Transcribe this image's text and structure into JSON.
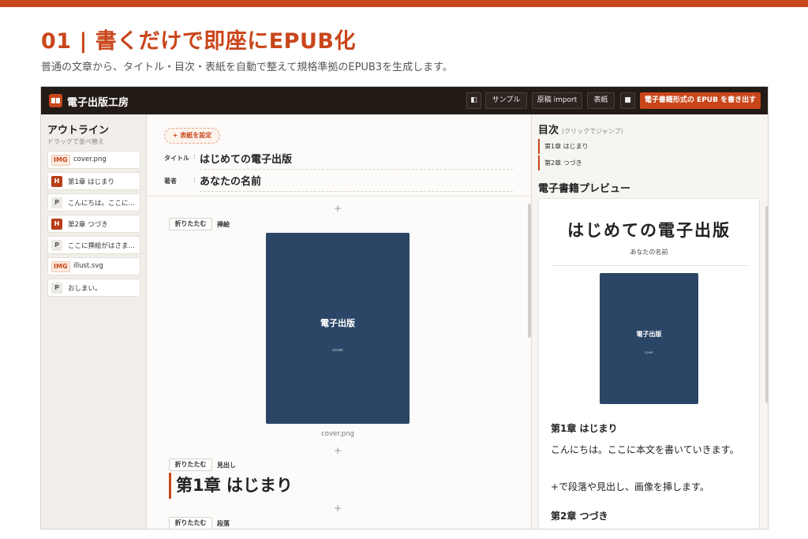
{
  "heading": "01 | 書くだけで即座にEPUB化",
  "subheading": "普通の文章から、タイトル・目次・表紙を自動で整えて規格準拠のEPUB3を生成します。",
  "app": {
    "title": "電子出版工房",
    "buttons": {
      "layout_icon": "◧",
      "sample": "サンプル",
      "import": "原稿 import",
      "cover": "表紙",
      "square_icon": "■",
      "export": "電子書籍形式の EPUB を書き出す"
    }
  },
  "sidebar": {
    "title": "アウトライン",
    "subtitle": "ドラッグで並べ替え",
    "items": [
      {
        "badge": "IMG",
        "kind": "img",
        "label": "cover.png"
      },
      {
        "badge": "H",
        "kind": "h",
        "label": "第1章 はじまり"
      },
      {
        "badge": "P",
        "kind": "p",
        "label": "こんにちは。ここに…"
      },
      {
        "badge": "H",
        "kind": "h",
        "label": "第2章 つづき"
      },
      {
        "badge": "P",
        "kind": "p",
        "label": "ここに挿絵がはさま…"
      },
      {
        "badge": "IMG",
        "kind": "img",
        "label": "illust.svg"
      },
      {
        "badge": "P",
        "kind": "p",
        "label": "おしまい。"
      }
    ]
  },
  "editor": {
    "cover_button": "+ 表紙を設定",
    "title_label": "タイトル",
    "title_value": "はじめての電子出版",
    "author_label": "著者",
    "author_value": "あなたの名前",
    "colon": ":",
    "plus": "+",
    "fold_label": "折りたたむ",
    "block1_type": "挿絵",
    "cover_title": "電子出版",
    "cover_sub": "cover",
    "cover_caption": "cover.png",
    "block2_type": "見出し",
    "chapter_heading": "第1章 はじまり",
    "block3_type": "段落"
  },
  "toc": {
    "title": "目次",
    "hint": "(クリックでジャンプ)",
    "items": [
      "第1章 はじまり",
      "第2章 つづき"
    ]
  },
  "preview": {
    "title": "電子書籍プレビュー",
    "book_title": "はじめての電子出版",
    "author": "あなたの名前",
    "cover_title": "電子出版",
    "cover_sub": "cover",
    "chapter1": "第1章 はじまり",
    "para1": "こんにちは。ここに本文を書いていきます。",
    "para2": "+で段落や見出し、画像を挿します。",
    "chapter2": "第2章 つづき"
  },
  "colors": {
    "accent": "#c9461b",
    "header_bg": "#231b16",
    "cover_bg": "#2b4566"
  }
}
